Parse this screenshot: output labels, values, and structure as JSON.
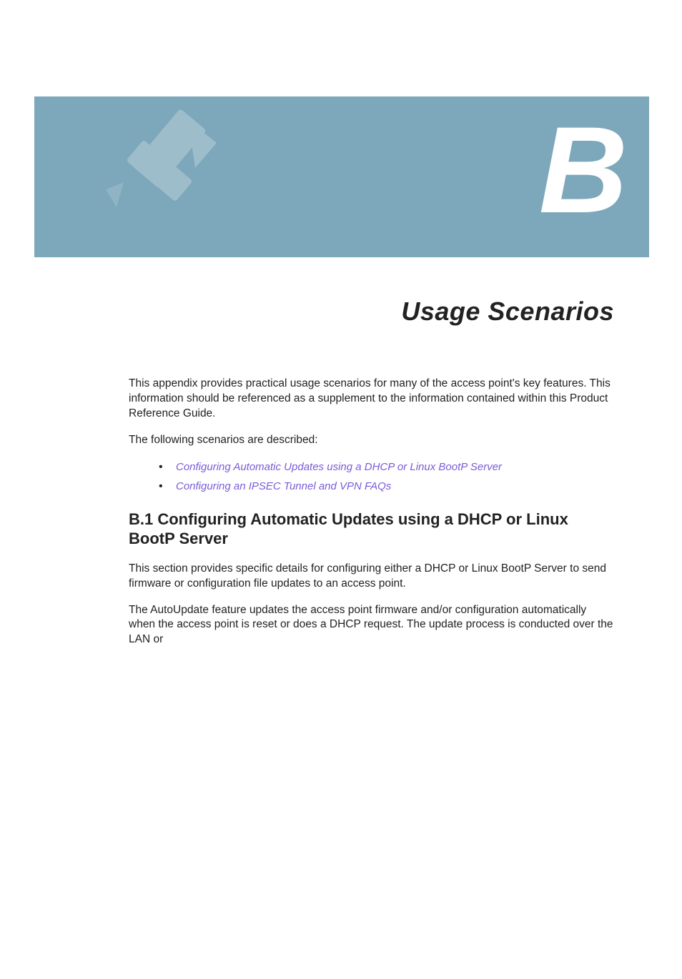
{
  "banner": {
    "letter": "B"
  },
  "title": "Usage Scenarios",
  "intro_para": "This appendix provides practical usage scenarios for many of the access point's key features. This information should be referenced as a supplement to the information contained within this Product Reference Guide.",
  "scenarios_lead": "The following scenarios are described:",
  "links": {
    "link1": "Configuring Automatic Updates using a DHCP or Linux BootP Server",
    "link2": "Configuring an IPSEC Tunnel and VPN FAQs"
  },
  "section": {
    "heading": "B.1  Configuring Automatic Updates using a DHCP or Linux BootP Server",
    "para1": "This section provides specific details for configuring either a DHCP or Linux BootP Server to send firmware or configuration file updates to an access point.",
    "para2": "The AutoUpdate feature updates the access point firmware and/or configuration automatically when the access point is reset or does a DHCP request. The update process is conducted over the LAN or"
  }
}
